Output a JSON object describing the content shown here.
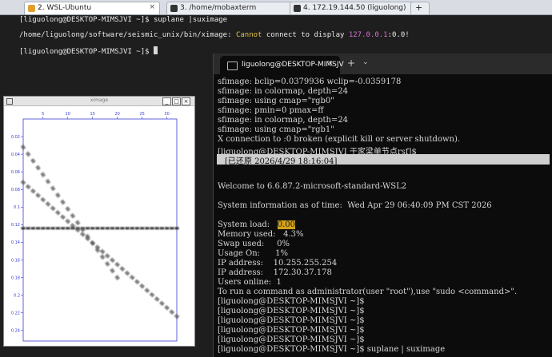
{
  "tabs": [
    {
      "label": "2. WSL-Ubuntu",
      "active": true,
      "icon": "penguin-icon"
    },
    {
      "label": "3. /home/mobaxterm",
      "active": false,
      "icon": "terminal-icon"
    },
    {
      "label": "4. 172.19.144.50 (liguolong)",
      "active": false,
      "icon": "terminal-icon"
    }
  ],
  "main_terminal": {
    "prompt_line": "[liguolong@DESKTOP-MIMSJVI ~]$ suplane |suximage",
    "error_path": "/home/liguolong/software/seismic_unix/bin/ximage: ",
    "error_cannot": "Cannot",
    "error_mid": " connect to display ",
    "error_ip": "127.0.0.1",
    "error_tail": ":0.0!",
    "prompt2": "[liguolong@DESKTOP-MIMSJVI ~]$ "
  },
  "wt": {
    "tab_title": "liguolong@DESKTOP-MIMSJV",
    "close_label": "×",
    "plus_label": "+",
    "dropdown_label": "⌄",
    "lines_top": [
      "sfimage: bclip=0.0379936 wclip=-0.0359178",
      "sfimage: in colormap, depth=24",
      "sfimage: using cmap=\"rgb0\"",
      "sfimage: pmin=0 pmax=ff",
      "sfimage: in colormap, depth=24",
      "sfimage: using cmap=\"rgb1\"",
      "X connection to :0 broken (explicit kill or server shutdown).",
      "[liguolong@DESKTOP-MIMSJVI 于家梁单节点rsf]$"
    ],
    "restored": "[已还原 2026/4/29 18:16:04]",
    "welcome": "Welcome to 6.6.87.2-microsoft-standard-WSL2",
    "sysinfo": "System information as of time:  Wed Apr 29 06:40:09 PM CST 2026",
    "stats": [
      {
        "key": "System load:   ",
        "value": "0.00"
      },
      {
        "key": "Memory used:   ",
        "value": "4.3%"
      },
      {
        "key": "Swap used:     ",
        "value": "0%"
      },
      {
        "key": "Usage On:      ",
        "value": "1%"
      },
      {
        "key": "IP address:    ",
        "value": "10.255.255.254"
      },
      {
        "key": "IP address:    ",
        "value": "172.30.37.178"
      },
      {
        "key": "Users online:  ",
        "value": "1"
      }
    ],
    "root_hint": "To run a command as administrator(user \"root\"),use \"sudo <command>\".",
    "prompts": [
      "[liguolong@DESKTOP-MIMSJVI ~]$",
      "[liguolong@DESKTOP-MIMSJVI ~]$",
      "[liguolong@DESKTOP-MIMSJVI ~]$",
      "[liguolong@DESKTOP-MIMSJVI ~]$",
      "[liguolong@DESKTOP-MIMSJVI ~]$",
      "[liguolong@DESKTOP-MIMSJVI ~]$ suplane | suximage"
    ]
  },
  "ximage": {
    "title": "ximage",
    "btn_min": "_",
    "btn_max": "□",
    "btn_close": "×",
    "x_ticks": [
      "5",
      "10",
      "15",
      "20",
      "25",
      "30"
    ],
    "y_ticks": [
      "0.02",
      "0.04",
      "0.06",
      "0.08",
      "0.1",
      "0.12",
      "0.14",
      "0.16",
      "0.18",
      "0.2",
      "0.22",
      "0.24"
    ],
    "x_range": [
      1,
      32
    ],
    "y_range": [
      0,
      0.252
    ],
    "events": [
      {
        "name": "horizontal",
        "x_start": 1,
        "x_end": 32,
        "t_start": 0.124,
        "t_end": 0.124
      },
      {
        "name": "steep dip",
        "x_start": 1,
        "x_end": 20,
        "t_start": 0.032,
        "t_end": 0.18
      },
      {
        "name": "gentle dip",
        "x_start": 1,
        "x_end": 32,
        "t_start": 0.072,
        "t_end": 0.224
      }
    ]
  }
}
